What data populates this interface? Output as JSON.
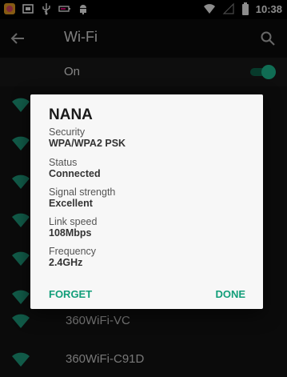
{
  "status_bar": {
    "time": "10:38",
    "icons": [
      "app-icon",
      "screenshot-icon",
      "usb-icon",
      "battery-saver-icon",
      "android-icon",
      "wifi-icon",
      "signal-icon",
      "battery-icon"
    ]
  },
  "app_bar": {
    "title": "Wi-Fi",
    "back_icon": "arrow-back-icon",
    "search_icon": "search-icon"
  },
  "wifi_toggle": {
    "label": "On",
    "state": "on"
  },
  "networks": [
    {
      "name": ""
    },
    {
      "name": ""
    },
    {
      "name": ""
    },
    {
      "name": ""
    },
    {
      "name": ""
    },
    {
      "name": ""
    },
    {
      "name": "360WiFi-VC"
    },
    {
      "name": "360WiFi-C91D"
    }
  ],
  "dialog": {
    "title": "NANA",
    "fields": [
      {
        "label": "Security",
        "value": "WPA/WPA2 PSK"
      },
      {
        "label": "Status",
        "value": "Connected"
      },
      {
        "label": "Signal strength",
        "value": "Excellent"
      },
      {
        "label": "Link speed",
        "value": "108Mbps"
      },
      {
        "label": "Frequency",
        "value": "2.4GHz"
      }
    ],
    "forget_label": "FORGET",
    "done_label": "DONE"
  },
  "colors": {
    "accent": "#129e79",
    "dialog_bg": "#f7f7f7",
    "list_bg": "#141414"
  }
}
